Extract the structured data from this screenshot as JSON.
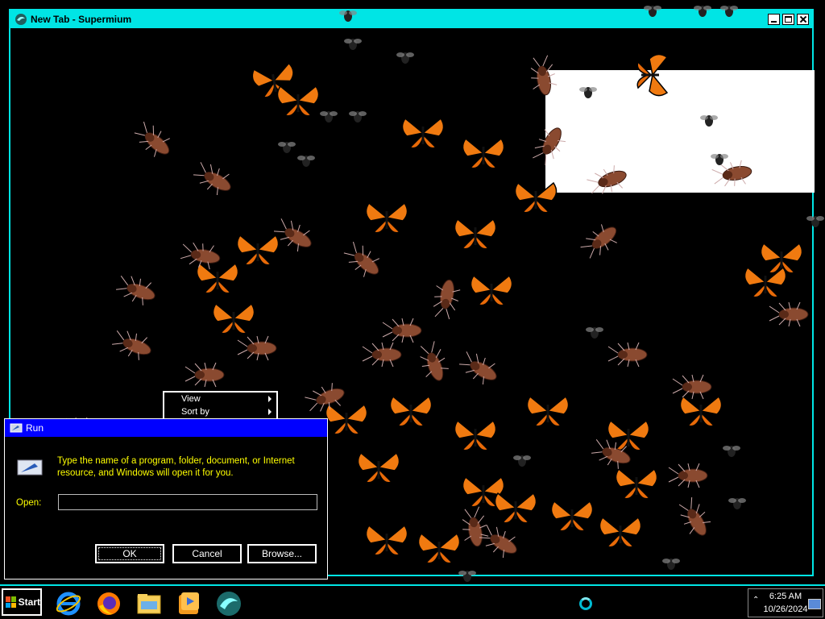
{
  "window": {
    "title": "New Tab - Supermium"
  },
  "context_menu": {
    "items": [
      {
        "label": "View"
      },
      {
        "label": "Sort by"
      }
    ]
  },
  "run_dialog": {
    "title": "Run",
    "message": "Type the name of a program, folder, document, or Internet resource, and Windows will open it for you.",
    "open_label": "Open:",
    "open_value": "",
    "ok_label": "OK",
    "cancel_label": "Cancel",
    "browse_label": "Browse..."
  },
  "taskbar": {
    "start_label": "Start",
    "pinned_icons": [
      "internet-explorer-icon",
      "firefox-icon",
      "file-explorer-icon",
      "media-player-icon",
      "supermium-icon"
    ],
    "time": "6:25 AM",
    "date": "10/26/2024"
  },
  "colors": {
    "accent": "#00e5e5",
    "run_title": "#0000ff",
    "dialog_text": "#ffff00"
  }
}
